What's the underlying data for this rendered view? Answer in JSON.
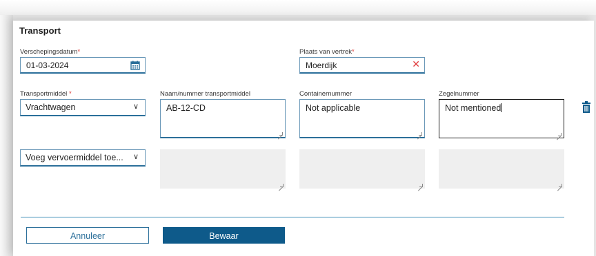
{
  "section": {
    "title": "Transport"
  },
  "shipping_date": {
    "label": "Verschepingsdatum",
    "required_mark": "*",
    "value": "01-03-2024"
  },
  "departure": {
    "label": "Plaats van vertrek",
    "required_mark": "*",
    "value": "Moerdijk"
  },
  "transport_mode": {
    "label": "Transportmiddel ",
    "required_mark": "*",
    "value": "Vrachtwagen"
  },
  "vehicle_id": {
    "label": "Naam/nummer transportmiddel",
    "value": "AB-12-CD"
  },
  "container_number": {
    "label": "Containernummer",
    "value": "Not applicable"
  },
  "seal_number": {
    "label": "Zegelnummer",
    "value": "Not mentioned"
  },
  "add_vehicle": {
    "value": "Voeg vervoermiddel toe..."
  },
  "buttons": {
    "cancel": "Annuleer",
    "save": "Bewaar"
  },
  "icons": {
    "calendar": "calendar-icon",
    "clear": "clear-icon",
    "delete": "trash-icon",
    "dropdown": "chevron-down-icon"
  },
  "colors": {
    "accent": "#0e5a8a",
    "required": "#d9302c"
  }
}
